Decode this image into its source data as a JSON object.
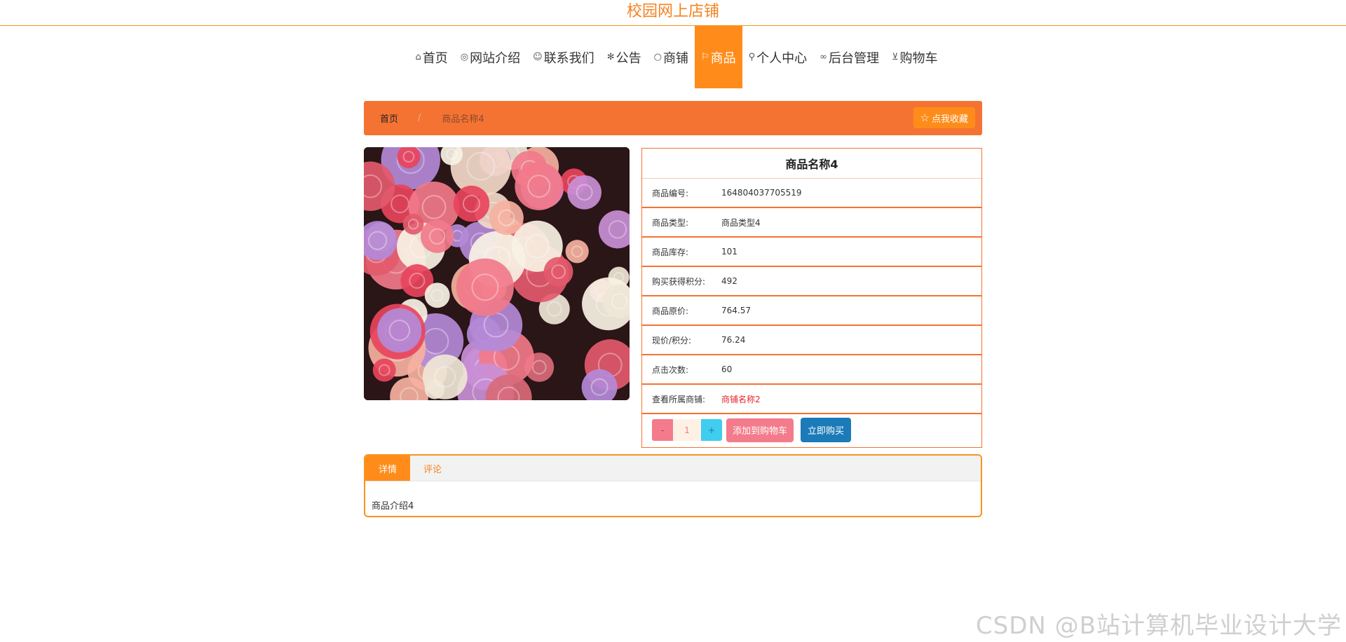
{
  "site": {
    "title": "校园网上店铺"
  },
  "nav": {
    "items": [
      {
        "label": "首页",
        "icon": "home-icon",
        "glyph": "⌂",
        "active": false
      },
      {
        "label": "网站介绍",
        "icon": "palette-icon",
        "glyph": "◎",
        "active": false
      },
      {
        "label": "联系我们",
        "icon": "support-icon",
        "glyph": "☺",
        "active": false
      },
      {
        "label": "公告",
        "icon": "snowflake-icon",
        "glyph": "✻",
        "active": false
      },
      {
        "label": "商铺",
        "icon": "circle-icon",
        "glyph": "○",
        "active": false
      },
      {
        "label": "商品",
        "icon": "flag-icon",
        "glyph": "⚐",
        "active": true
      },
      {
        "label": "个人中心",
        "icon": "user-icon",
        "glyph": "⚲",
        "active": false
      },
      {
        "label": "后台管理",
        "icon": "link-icon",
        "glyph": "∞",
        "active": false
      },
      {
        "label": "购物车",
        "icon": "cart-icon",
        "glyph": "⊻",
        "active": false
      }
    ]
  },
  "breadcrumb": {
    "home": "首页",
    "separator": "/",
    "current": "商品名称4",
    "favorite_label": "点我收藏",
    "favorite_icon": "star-icon"
  },
  "product": {
    "name": "商品名称4",
    "fields": [
      {
        "label": "商品编号:",
        "value": "164804037705519"
      },
      {
        "label": "商品类型:",
        "value": "商品类型4"
      },
      {
        "label": "商品库存:",
        "value": "101"
      },
      {
        "label": "购买获得积分:",
        "value": "492"
      },
      {
        "label": "商品原价:",
        "value": "764.57"
      },
      {
        "label": "现价/积分:",
        "value": "76.24"
      },
      {
        "label": "点击次数:",
        "value": "60"
      }
    ],
    "shop_label": "查看所属商铺:",
    "shop_name": "商铺名称2",
    "quantity": "1",
    "minus": "-",
    "plus": "+",
    "add_cart": "添加到购物车",
    "buy_now": "立即购买"
  },
  "detail": {
    "tabs": [
      {
        "label": "详情",
        "active": true
      },
      {
        "label": "评论",
        "active": false
      }
    ],
    "content": "商品介绍4"
  },
  "watermark": "CSDN @B站计算机毕业设计大学",
  "colors": {
    "accent": "#ff8c1a",
    "breadcrumb": "#f57332",
    "pink": "#f37b8b",
    "cyan": "#3fcdf0",
    "blue": "#1b7bb8",
    "link": "#e8222a"
  }
}
